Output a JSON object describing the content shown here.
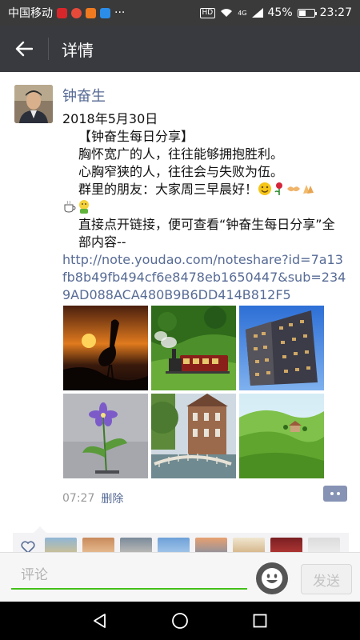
{
  "status_bar": {
    "carrier": "中国移动",
    "more_indicator": "···",
    "hd": "HD",
    "network": "4G",
    "battery_percent": "45%",
    "battery_level": 0.45,
    "time": "23:27"
  },
  "nav": {
    "back_icon": "arrow-left-icon",
    "title": "详情"
  },
  "post": {
    "author": "钟奋生",
    "date": "2018年5月30日",
    "line1": "【钟奋生每日分享】",
    "line2": "胸怀宽广的人，往往能够拥抱胜利。",
    "line3": "心胸窄狭的人，往往会与失败为伍。",
    "line4": "群里的朋友：大家周三早晨好！",
    "line5": "直接点开链接，便可查看“钟奋生每日分享”全部内容--",
    "link": "http://note.youdao.com/noteshare?id=7a13fb8b49fb494cf6e8478eb1650447&sub=2349AD088ACA480B9B6DD414B812F5",
    "photos": [
      "crane-sunset-photo",
      "steam-train-photo",
      "modern-building-photo",
      "purple-flower-photo",
      "bridge-house-photo",
      "green-hills-photo"
    ],
    "time": "07:27",
    "delete_label": "删除"
  },
  "comment": {
    "placeholder": "评论",
    "send_label": "发送"
  }
}
